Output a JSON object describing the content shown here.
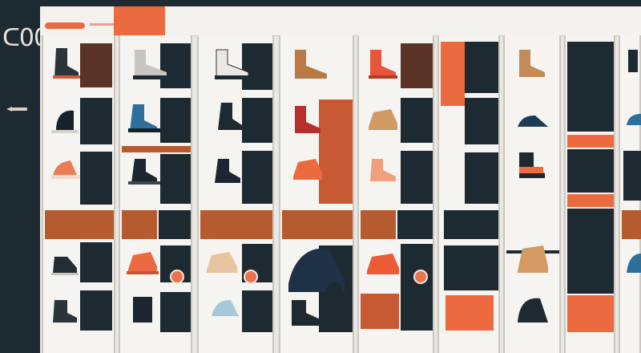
{
  "brand": {
    "logo_text": "ᑕ00"
  },
  "header": {
    "accent_label": ""
  },
  "colors": {
    "dark": "#1e2a31",
    "orange": "#ec6a40",
    "rust": "#b65a2f",
    "tan": "#c88a57",
    "light": "#f6f4f1",
    "navy": "#233a52",
    "blue": "#2e6f9c"
  },
  "columns": [
    {
      "name": "column-1"
    },
    {
      "name": "column-2"
    },
    {
      "name": "column-3"
    },
    {
      "name": "column-4"
    },
    {
      "name": "column-5"
    },
    {
      "name": "column-6"
    },
    {
      "name": "column-7"
    },
    {
      "name": "column-8"
    }
  ]
}
